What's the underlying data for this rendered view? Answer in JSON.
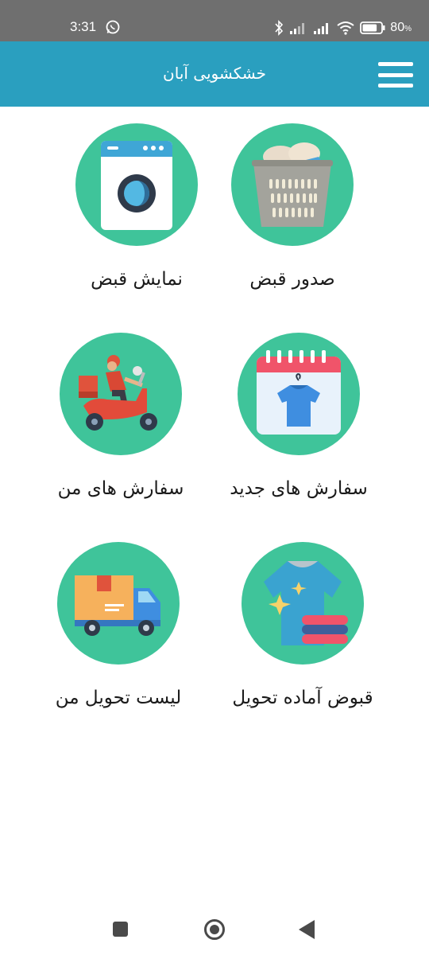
{
  "status_bar": {
    "time": "3:31",
    "battery_percent": "80",
    "battery_unit": "%",
    "battery_level": 0.8
  },
  "app_bar": {
    "title": "خشکشویی آبان",
    "menu_icon": "hamburger-menu-icon"
  },
  "colors": {
    "app_bar": "#2a9fbf",
    "status_bar": "#6f6f6f",
    "tile_circle": "#3fc49a",
    "text": "#1a1a1a"
  },
  "tiles": [
    {
      "label": "صدور قبض",
      "icon": "laundry-basket-icon"
    },
    {
      "label": "نمایش قبض",
      "icon": "washing-machine-icon"
    },
    {
      "label": "سفارش های جدید",
      "icon": "calendar-shirt-icon"
    },
    {
      "label": "سفارش های من",
      "icon": "delivery-scooter-icon"
    },
    {
      "label": "قبوض آماده تحویل",
      "icon": "clean-shirt-icon"
    },
    {
      "label": "لیست تحویل من",
      "icon": "delivery-truck-icon"
    }
  ],
  "nav_bar": {
    "recent_icon": "recent-apps-icon",
    "home_icon": "home-icon",
    "back_icon": "back-icon"
  }
}
